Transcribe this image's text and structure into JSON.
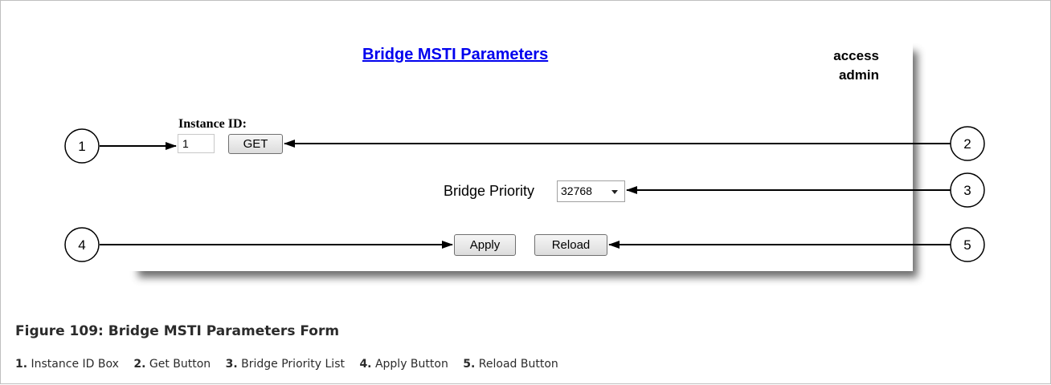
{
  "form": {
    "title": "Bridge MSTI Parameters",
    "user_line1": "access",
    "user_line2": "admin",
    "instance_id_label": "Instance ID:",
    "instance_id_value": "1",
    "get_label": "GET",
    "bridge_priority_label": "Bridge Priority",
    "bridge_priority_value": "32768",
    "apply_label": "Apply",
    "reload_label": "Reload"
  },
  "callouts": [
    "1",
    "2",
    "3",
    "4",
    "5"
  ],
  "caption": "Figure 109: Bridge MSTI Parameters Form",
  "legend": [
    {
      "num": "1.",
      "text": "Instance ID Box"
    },
    {
      "num": "2.",
      "text": "Get Button"
    },
    {
      "num": "3.",
      "text": "Bridge Priority List"
    },
    {
      "num": "4.",
      "text": "Apply Button"
    },
    {
      "num": "5.",
      "text": "Reload Button"
    }
  ]
}
